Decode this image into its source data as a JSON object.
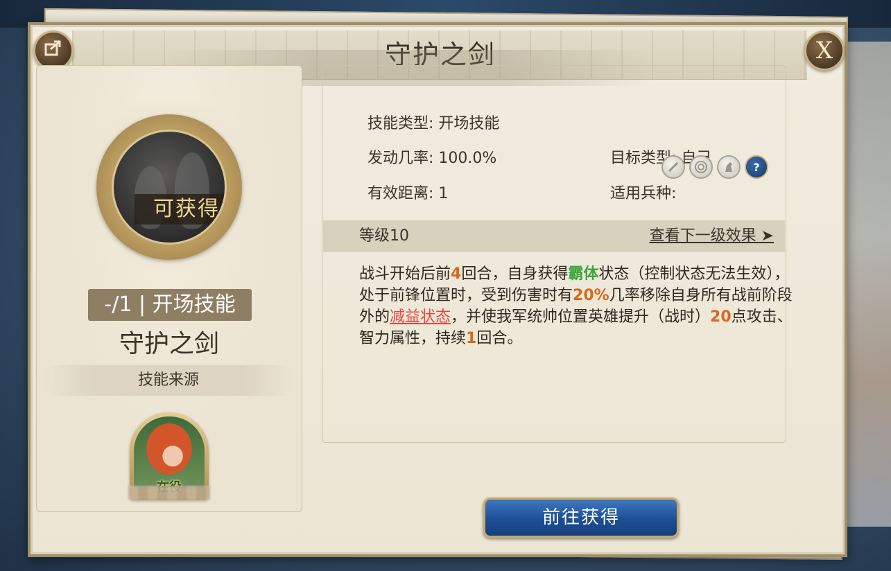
{
  "dialog": {
    "title": "守护之剑",
    "share_icon": "share-icon",
    "close_label": "X"
  },
  "left": {
    "obtainable_label": "可获得",
    "type_badge": "-/1 | 开场技能",
    "skill_name": "守护之剑",
    "source_label": "技能来源",
    "hero_status": "在役"
  },
  "info": {
    "skill_type_label": "技能类型:",
    "skill_type_value": "开场技能",
    "trigger_rate_label": "发动几率:",
    "trigger_rate_value": "100.0%",
    "target_type_label": "目标类型:",
    "target_type_value": "自己",
    "range_label": "有效距离:",
    "range_value": "1",
    "unit_types_label": "适用兵种:",
    "unit_icons": [
      "sword-icon",
      "target-icon",
      "horse-icon",
      "question-icon"
    ]
  },
  "level": {
    "label": "等级10",
    "next_link": "查看下一级效果 ➤"
  },
  "description": {
    "p1": "战斗开始后前",
    "n1": "4",
    "p2": "回合，自身获得",
    "k1": "霸体",
    "p3": "状态（控制状态无法生效），处于前锋位置时，受到伤害时有",
    "n2": "20%",
    "p4": "几率移除自身所有战前阶段外的",
    "k2": "减益状态",
    "p5": "，并使我军统帅位置英雄提升（战时）",
    "n3": "20",
    "p6": "点攻击、智力属性，持续",
    "n4": "1",
    "p7": "回合。"
  },
  "actions": {
    "go_obtain": "前往获得"
  },
  "colors": {
    "highlight_number": "#d66b1d",
    "highlight_green": "#3aa53a",
    "highlight_red": "#e2483e",
    "button_blue": "#1d4f95",
    "frame_gold": "#caa964"
  }
}
